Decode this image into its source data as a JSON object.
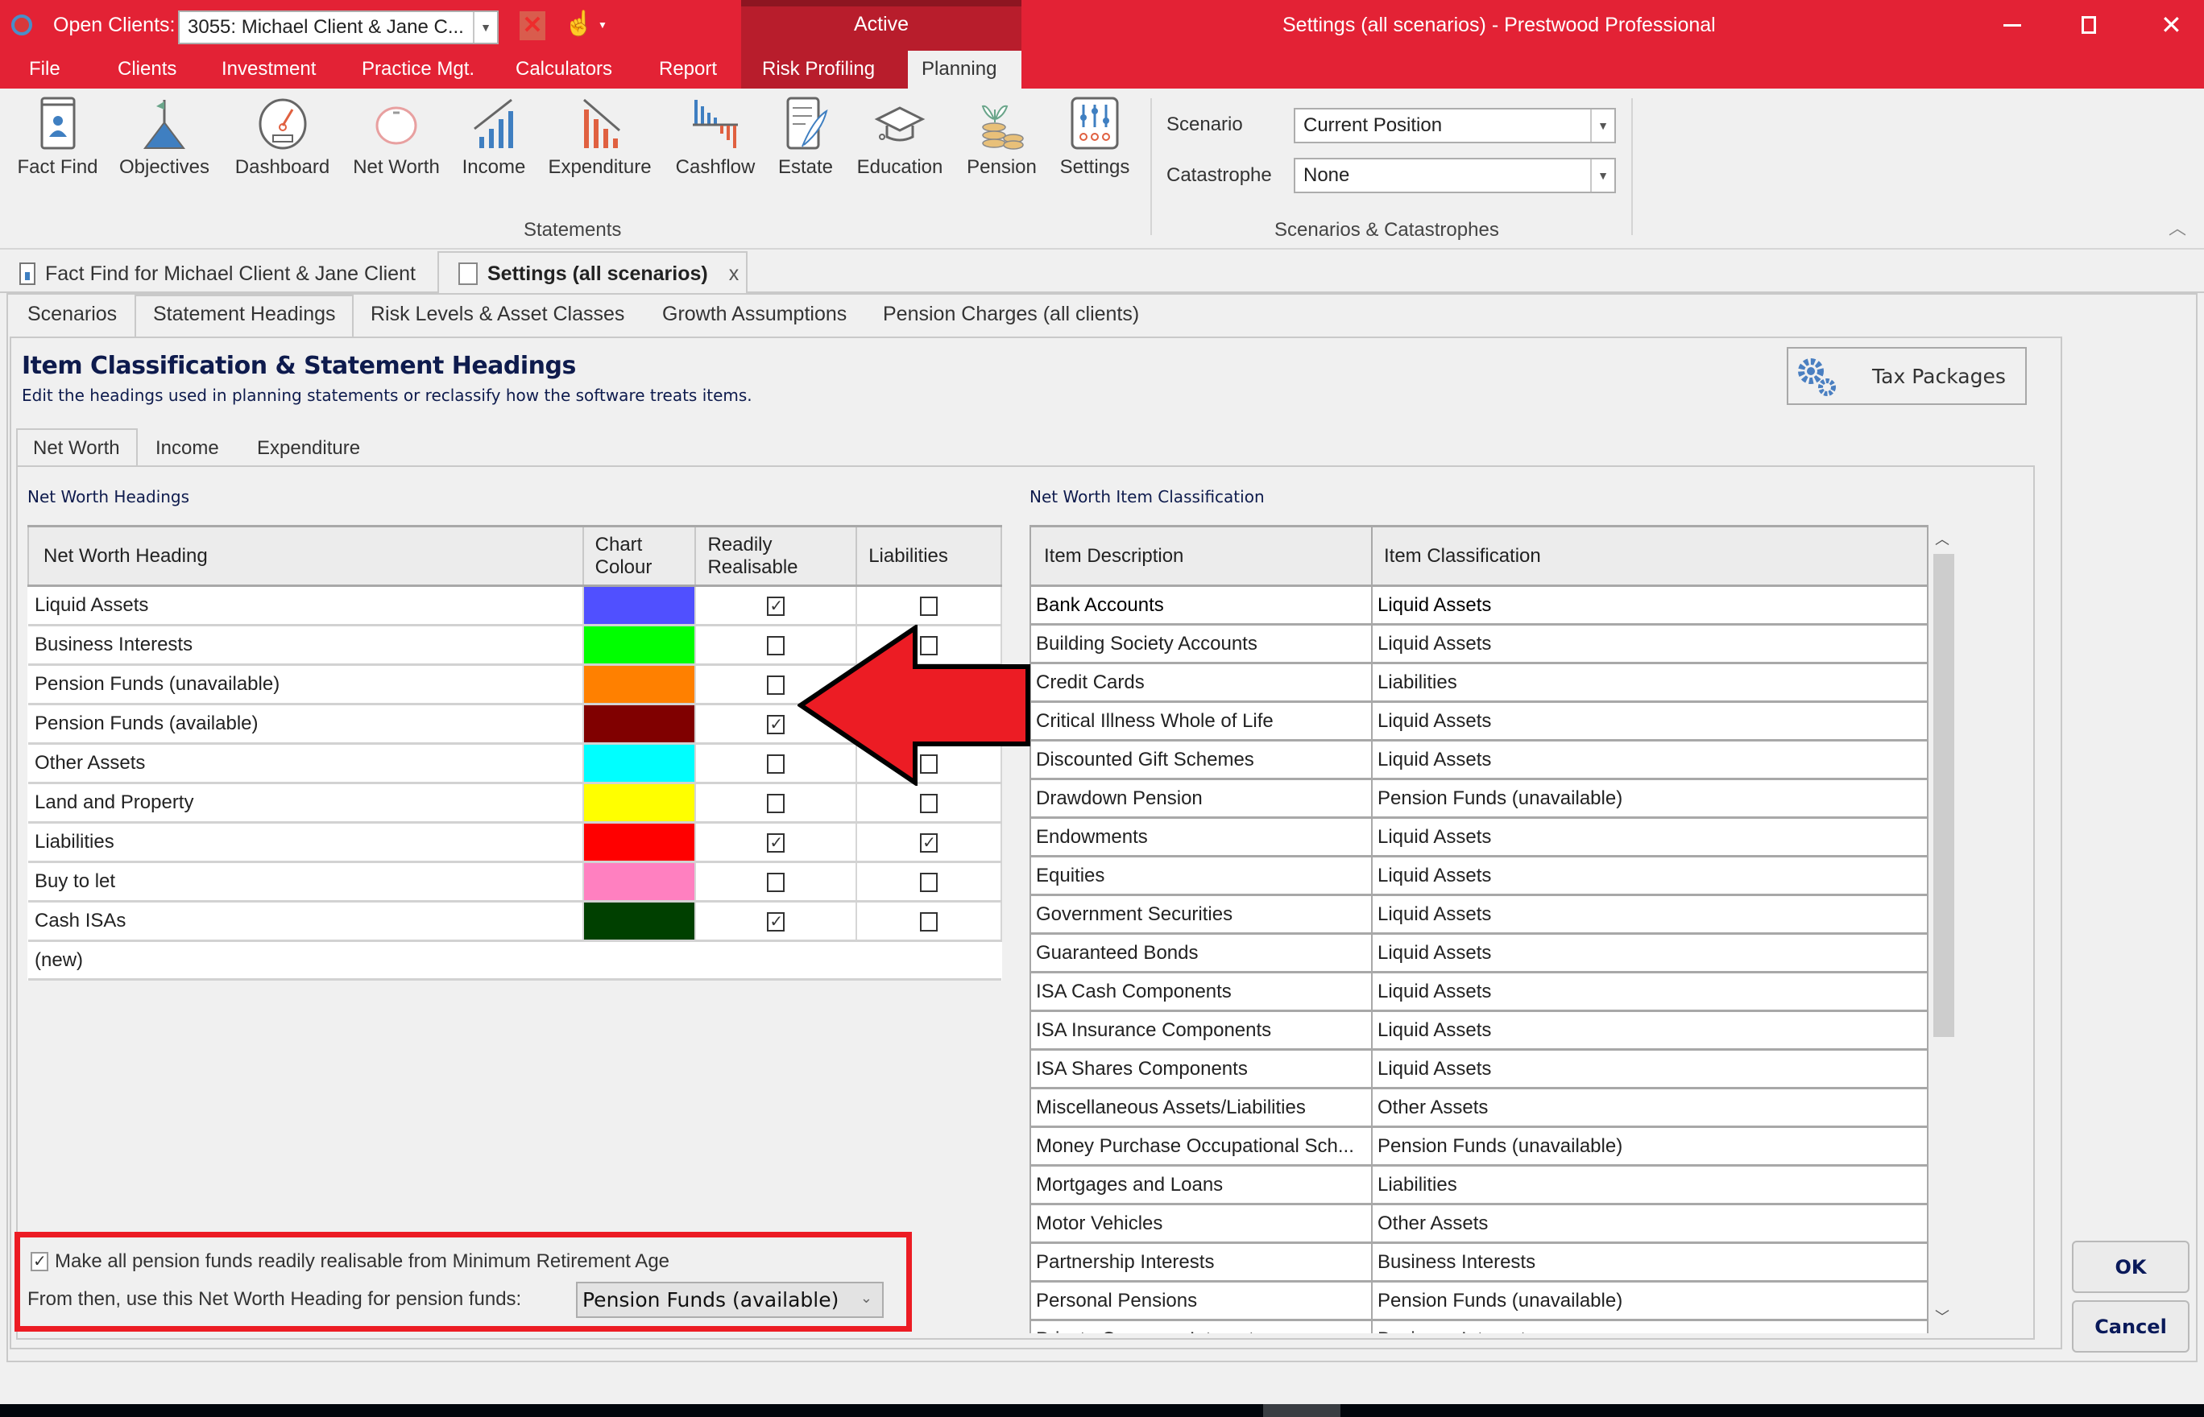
{
  "titlebar": {
    "open_clients_label": "Open Clients:",
    "open_clients_value": "3055: Michael Client & Jane C...",
    "active_label": "Active",
    "window_title": "Settings (all scenarios) - Prestwood Professional"
  },
  "menu": {
    "items": [
      "File",
      "Clients",
      "Investment",
      "Practice Mgt.",
      "Calculators",
      "Report",
      "Risk Profiling",
      "Planning"
    ]
  },
  "ribbon": {
    "statements_buttons": [
      "Fact Find",
      "Objectives",
      "Dashboard",
      "Net Worth",
      "Income",
      "Expenditure",
      "Cashflow",
      "Estate",
      "Education",
      "Pension",
      "Settings"
    ],
    "statements_group_label": "Statements",
    "scenario_label": "Scenario",
    "scenario_value": "Current Position",
    "catastrophe_label": "Catastrophe",
    "catastrophe_value": "None",
    "scenarios_group_label": "Scenarios & Catastrophes"
  },
  "doc_tabs": {
    "fact_find": "Fact Find for Michael Client & Jane Client",
    "settings": "Settings (all scenarios)",
    "close": "x"
  },
  "page_tabs": [
    "Scenarios",
    "Statement Headings",
    "Risk Levels & Asset Classes",
    "Growth Assumptions",
    "Pension Charges (all clients)"
  ],
  "section": {
    "title": "Item Classification & Statement Headings",
    "subtitle": "Edit the headings used in planning statements or reclassify how the software treats items.",
    "tax_packages_label": "Tax Packages"
  },
  "sub_tabs": [
    "Net Worth",
    "Income",
    "Expenditure"
  ],
  "headings_table": {
    "caption": "Net Worth Headings",
    "columns": [
      "Net Worth Heading",
      "Chart Colour",
      "Readily Realisable",
      "Liabilities"
    ],
    "chart_colour_line1": "Chart",
    "chart_colour_line2": "Colour",
    "readily_line1": "Readily",
    "readily_line2": "Realisable",
    "rows": [
      {
        "heading": "Liquid Assets",
        "colour": "#5050ff",
        "readily_realisable": true,
        "liabilities": false
      },
      {
        "heading": "Business Interests",
        "colour": "#00ff00",
        "readily_realisable": false,
        "liabilities": false
      },
      {
        "heading": "Pension Funds (unavailable)",
        "colour": "#ff8000",
        "readily_realisable": false,
        "liabilities": false
      },
      {
        "heading": "Pension Funds (available)",
        "colour": "#800000",
        "readily_realisable": true,
        "liabilities": false
      },
      {
        "heading": "Other Assets",
        "colour": "#00ffff",
        "readily_realisable": false,
        "liabilities": false
      },
      {
        "heading": "Land and Property",
        "colour": "#ffff00",
        "readily_realisable": false,
        "liabilities": false
      },
      {
        "heading": "Liabilities",
        "colour": "#ff0000",
        "readily_realisable": true,
        "liabilities": true
      },
      {
        "heading": "Buy to let",
        "colour": "#ff80c0",
        "readily_realisable": false,
        "liabilities": false
      },
      {
        "heading": "Cash ISAs",
        "colour": "#004000",
        "readily_realisable": true,
        "liabilities": false
      }
    ],
    "new_row_label": "(new)"
  },
  "classification_table": {
    "caption": "Net Worth Item Classification",
    "columns": [
      "Item Description",
      "Item Classification"
    ],
    "rows": [
      {
        "description": "Bank Accounts",
        "classification": "Liquid Assets"
      },
      {
        "description": "Building Society Accounts",
        "classification": "Liquid Assets"
      },
      {
        "description": "Credit Cards",
        "classification": "Liabilities"
      },
      {
        "description": "Critical Illness Whole of Life",
        "classification": "Liquid Assets"
      },
      {
        "description": "Discounted Gift Schemes",
        "classification": "Liquid Assets"
      },
      {
        "description": "Drawdown Pension",
        "classification": "Pension Funds (unavailable)"
      },
      {
        "description": "Endowments",
        "classification": "Liquid Assets"
      },
      {
        "description": "Equities",
        "classification": "Liquid Assets"
      },
      {
        "description": "Government Securities",
        "classification": "Liquid Assets"
      },
      {
        "description": "Guaranteed Bonds",
        "classification": "Liquid Assets"
      },
      {
        "description": "ISA Cash Components",
        "classification": "Liquid Assets"
      },
      {
        "description": "ISA Insurance Components",
        "classification": "Liquid Assets"
      },
      {
        "description": "ISA Shares Components",
        "classification": "Liquid Assets"
      },
      {
        "description": "Miscellaneous Assets/Liabilities",
        "classification": "Other Assets"
      },
      {
        "description": "Money Purchase Occupational Sch...",
        "classification": "Pension Funds (unavailable)"
      },
      {
        "description": "Mortgages and Loans",
        "classification": "Liabilities"
      },
      {
        "description": "Motor Vehicles",
        "classification": "Other Assets"
      },
      {
        "description": "Partnership Interests",
        "classification": "Business Interests"
      },
      {
        "description": "Personal Pensions",
        "classification": "Pension Funds (unavailable)"
      },
      {
        "description": "Private Company Interests",
        "classification": "Business Interests"
      }
    ]
  },
  "pension_option": {
    "checkbox_label": "Make all pension funds readily realisable from Minimum Retirement Age",
    "checked": true,
    "heading_label": "From then, use this Net Worth Heading for pension funds:",
    "heading_value": "Pension Funds (available)"
  },
  "buttons": {
    "ok": "OK",
    "cancel": "Cancel"
  },
  "colors": {
    "brand_red": "#e32235",
    "annotation_red": "#ec1c24"
  }
}
